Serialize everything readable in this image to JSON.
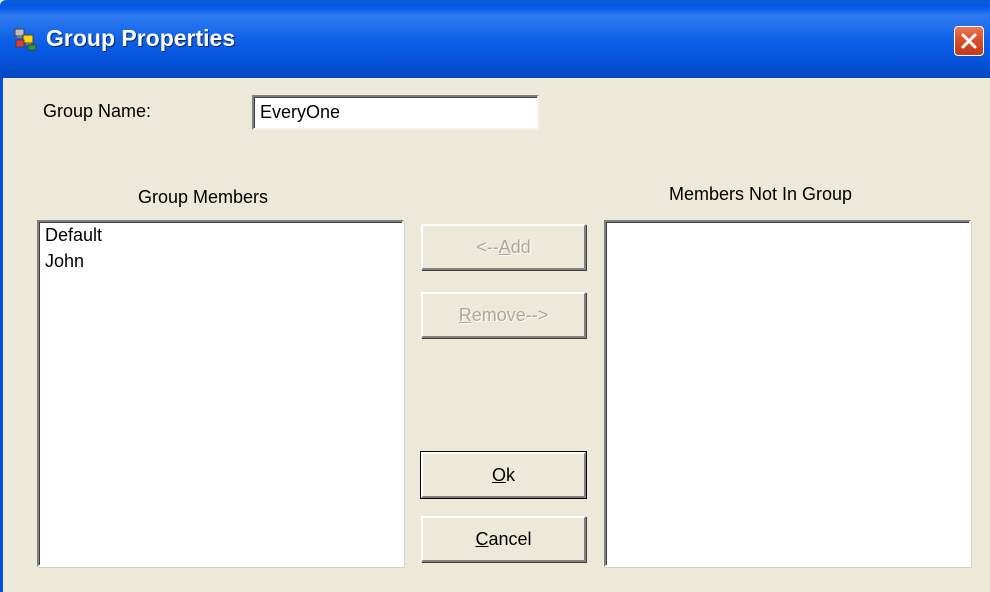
{
  "window": {
    "title": "Group Properties",
    "icon": "groups-app-icon",
    "close_icon": "close-icon",
    "title_color": "#ffffff",
    "titlebar_color": "#0058e6",
    "close_color": "#d9502c"
  },
  "group_name": {
    "label": "Group Name:",
    "value": "EveryOne"
  },
  "group_members": {
    "header": "Group Members",
    "items": [
      "Default",
      "John"
    ]
  },
  "members_not_in_group": {
    "header": "Members Not In Group",
    "items": []
  },
  "buttons": {
    "add": {
      "prefix": "<--",
      "accel": "A",
      "rest": "dd",
      "enabled": false
    },
    "remove": {
      "prefix": "",
      "accel": "R",
      "rest": "emove-->",
      "enabled": false
    },
    "ok": {
      "prefix": "",
      "accel": "O",
      "rest": "k",
      "enabled": true,
      "default": true
    },
    "cancel": {
      "prefix": "",
      "accel": "C",
      "rest": "ancel",
      "enabled": true
    }
  }
}
